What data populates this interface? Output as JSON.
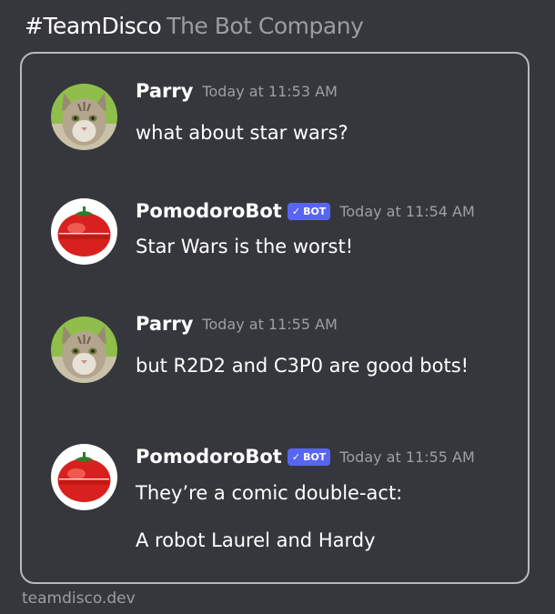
{
  "header": {
    "brand": "#TeamDisco",
    "company": "The Bot Company"
  },
  "messages": [
    {
      "avatar": "kitten-avatar",
      "username": "Parry",
      "is_bot": false,
      "timestamp": "Today at 11:53 AM",
      "lines": [
        "what about star wars?"
      ]
    },
    {
      "avatar": "tomato-timer-avatar",
      "username": "PomodoroBot",
      "is_bot": true,
      "bot_label": "BOT",
      "timestamp": "Today at 11:54 AM",
      "lines": [
        "Star Wars is the worst!"
      ]
    },
    {
      "avatar": "kitten-avatar",
      "username": "Parry",
      "is_bot": false,
      "timestamp": "Today at 11:55 AM",
      "lines": [
        "but R2D2 and C3P0 are good bots!"
      ]
    },
    {
      "avatar": "tomato-timer-avatar",
      "username": "PomodoroBot",
      "is_bot": true,
      "bot_label": "BOT",
      "timestamp": "Today at 11:55 AM",
      "lines": [
        "They’re a comic double-act:",
        "A robot Laurel and Hardy"
      ]
    }
  ],
  "footer": {
    "site": "teamdisco.dev"
  },
  "colors": {
    "background": "#36373d",
    "card_border": "#b8b8bd",
    "bot_tag": "#5865f2",
    "timestamp": "#9d9fa6"
  }
}
